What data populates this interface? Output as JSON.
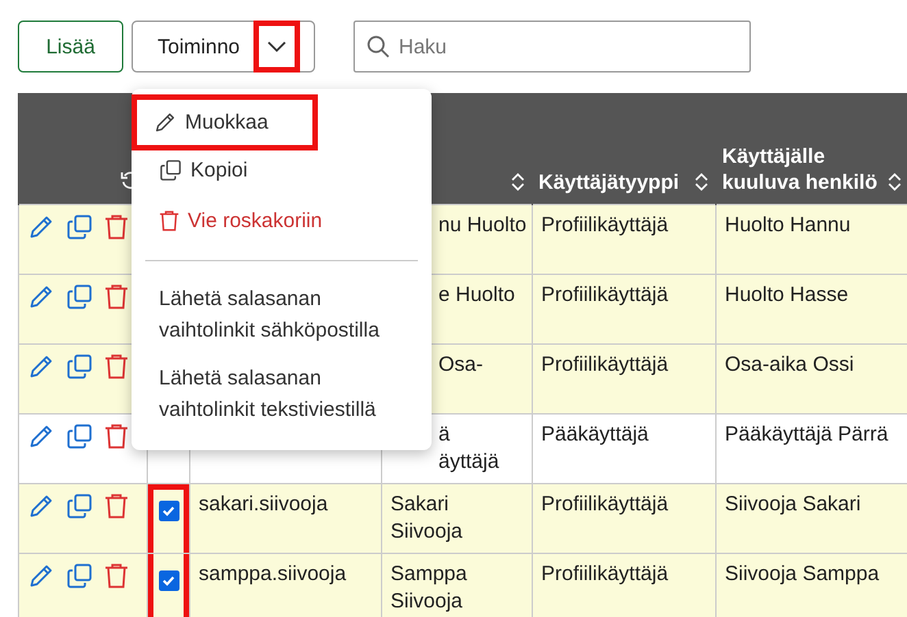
{
  "toolbar": {
    "add_button": "Lisää",
    "actions_button": {
      "label": "Toiminno",
      "marked": true
    },
    "search": {
      "placeholder": "Haku"
    }
  },
  "menu": {
    "items": [
      {
        "kind": "edit",
        "label": "Muokkaa",
        "marked": true
      },
      {
        "kind": "copy",
        "label": "Kopioi",
        "marked": false
      },
      {
        "kind": "delete",
        "label": "Vie roskakoriin",
        "marked": false
      },
      {
        "kind": "divider"
      },
      {
        "kind": "text",
        "label": "Lähetä salasanan vaihtolinkit sähköpostilla",
        "marked": false
      },
      {
        "kind": "text",
        "label": "Lähetä salasanan vaihtolinkit tekstiviestillä",
        "marked": false
      }
    ]
  },
  "table": {
    "columns": [
      {
        "kind": "reset"
      },
      {
        "kind": "blank"
      },
      {
        "kind": "blank"
      },
      {
        "kind": "sort"
      },
      {
        "kind": "sort",
        "label": "Käyttäjätyyppi"
      },
      {
        "kind": "sort",
        "label": "Käyttäjälle kuuluva henkilö"
      }
    ],
    "rows": [
      {
        "highlighted": true,
        "covered": true,
        "name": "nu Huolto",
        "type": "Profiilikäyttäjä",
        "person": "Huolto Hannu"
      },
      {
        "highlighted": true,
        "covered": true,
        "name": "e Huolto",
        "type": "Profiilikäyttäjä",
        "person": "Huolto Hasse"
      },
      {
        "highlighted": true,
        "covered": true,
        "name": "Osa-",
        "type": "Profiilikäyttäjä",
        "person": "Osa-aika Ossi"
      },
      {
        "highlighted": false,
        "covered": true,
        "name": "ä\näyttäjä",
        "type": "Pääkäyttäjä",
        "person": "Pääkäyttäjä Pärrä"
      },
      {
        "highlighted": true,
        "covered": false,
        "checked": true,
        "marked": true,
        "username": "sakari.siivooja",
        "name": "Sakari Siivooja",
        "type": "Profiilikäyttäjä",
        "person": "Siivooja Sakari"
      },
      {
        "highlighted": true,
        "covered": false,
        "checked": true,
        "marked": true,
        "username": "samppa.siivooja",
        "name": "Samppa Siivooja",
        "type": "Profiilikäyttäjä",
        "person": "Siivooja Samppa"
      }
    ]
  }
}
